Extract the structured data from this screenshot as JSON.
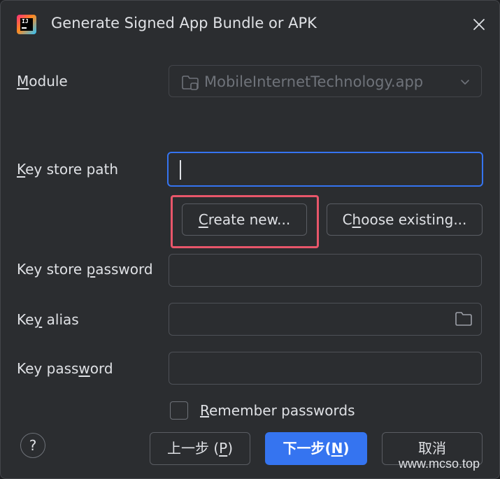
{
  "window": {
    "title": "Generate Signed App Bundle or APK",
    "app_icon_text": "IJ"
  },
  "module": {
    "label_mnemonic": "M",
    "label_rest": "odule",
    "value": "MobileInternetTechnology.app"
  },
  "key_store_path": {
    "label_mnemonic": "K",
    "label_rest": "ey store path",
    "value": ""
  },
  "buttons": {
    "create_new_pre": "",
    "create_new_mnemonic": "C",
    "create_new_rest": "reate new...",
    "choose_existing_pre": "C",
    "choose_existing_mnemonic": "h",
    "choose_existing_rest": "oose existing..."
  },
  "key_store_password": {
    "label_pre": "Key store ",
    "label_mnemonic": "p",
    "label_rest": "assword",
    "value": ""
  },
  "key_alias": {
    "label_pre": "Ke",
    "label_mnemonic": "y",
    "label_rest": " alias",
    "value": ""
  },
  "key_password": {
    "label_pre": "Key pass",
    "label_mnemonic": "w",
    "label_rest": "ord",
    "value": ""
  },
  "remember": {
    "label_mnemonic": "R",
    "label_rest": "emember passwords",
    "checked": false
  },
  "footer": {
    "help_label": "?",
    "prev_pre": "上一步 (",
    "prev_mnemonic": "P",
    "prev_post": ")",
    "next_pre": "下一步(",
    "next_mnemonic": "N",
    "next_post": ")",
    "cancel_label": "取消"
  },
  "watermark": "www.mcso.top",
  "colors": {
    "accent": "#3574f0",
    "highlight": "#e8566a",
    "background": "#2b2d30"
  }
}
